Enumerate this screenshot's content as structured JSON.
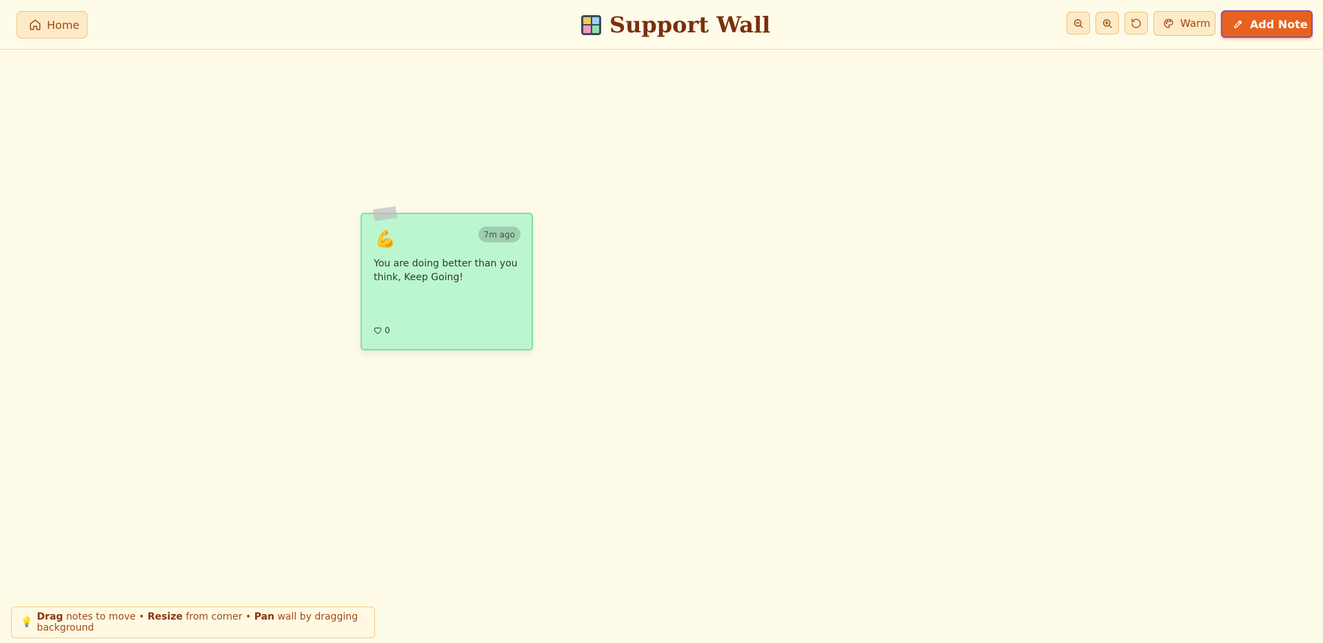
{
  "header": {
    "home_label": "Home",
    "title": "Support Wall",
    "theme_label": "Warm",
    "add_note_label": "Add Note"
  },
  "icons": {
    "home": "home-icon",
    "zoom_out": "zoom-out-icon",
    "zoom_in": "zoom-in-icon",
    "reset": "reset-icon",
    "palette": "palette-icon",
    "add_note": "pencil-icon",
    "wall": "wall-grid-icon",
    "like": "heart-icon",
    "hint": "lightbulb-icon"
  },
  "notes": [
    {
      "emoji": "💪",
      "time": "7m ago",
      "text": "You are doing better than you think, Keep Going!",
      "likes": "0",
      "color": "#bcf6d0"
    }
  ],
  "hint": {
    "drag_word": "Drag",
    "drag_text": "notes to move •",
    "resize_word": "Resize",
    "resize_text": "from corner •",
    "pan_word": "Pan",
    "pan_text": "wall by dragging background"
  },
  "colors": {
    "accent": "#e8621f",
    "title": "#7a2f0d",
    "background": "#fefae8"
  }
}
